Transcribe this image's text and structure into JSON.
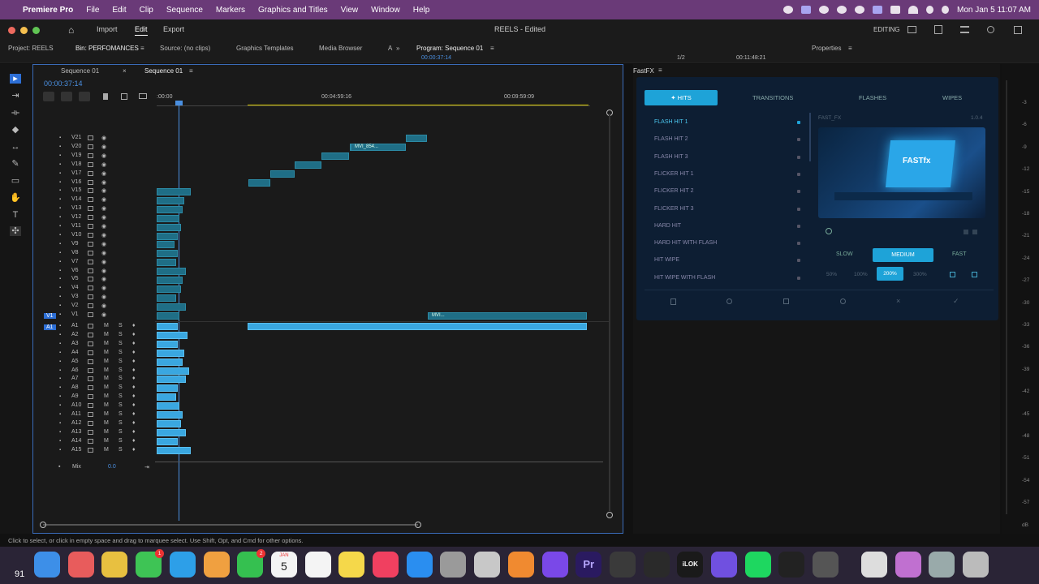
{
  "menubar": {
    "app": "Premiere Pro",
    "items": [
      "File",
      "Edit",
      "Clip",
      "Sequence",
      "Markers",
      "Graphics and Titles",
      "View",
      "Window",
      "Help"
    ],
    "clock": "Mon Jan 5  11:07 AM"
  },
  "apptop": {
    "home": "home-icon",
    "import": "Import",
    "edit": "Edit",
    "export": "Export",
    "title": "REELS - Edited",
    "workspace": "EDITING"
  },
  "tabs": {
    "project": "Project: REELS",
    "bin": "Bin: PERFOMANCES",
    "source": "Source: (no clips)",
    "graphics": "Graphics Templates",
    "media": "Media Browser",
    "more": "A",
    "program": "Program: Sequence 01",
    "program_time": "00:00:37:14",
    "program_dur": "00:11:48:21",
    "program_zoom": "1/2",
    "properties": "Properties"
  },
  "timeline": {
    "seq_tab1": "Sequence 01",
    "seq_tab2": "Sequence 01",
    "timecode": "00:00:37:14",
    "ruler": [
      ":00:00",
      "00:04:59:16",
      "00:09:59:09"
    ],
    "video_tracks": [
      "V21",
      "V20",
      "V19",
      "V18",
      "V17",
      "V16",
      "V15",
      "V14",
      "V13",
      "V12",
      "V11",
      "V10",
      "V9",
      "V8",
      "V7",
      "V6",
      "V5",
      "V4",
      "V3",
      "V2",
      "V1"
    ],
    "audio_tracks": [
      "A1",
      "A2",
      "A3",
      "A4",
      "A5",
      "A6",
      "A7",
      "A8",
      "A9",
      "A10",
      "A11",
      "A12",
      "A13",
      "A14",
      "A15"
    ],
    "v1_src": "V1",
    "a1_src": "A1",
    "mix_label": "Mix",
    "mix_value": "0.0",
    "clip_v20": "MVI_854...",
    "clip_v1": "MVI..."
  },
  "fastfx": {
    "panel_title": "FastFX",
    "tabs": [
      "HITS",
      "TRANSITIONS",
      "FLASHES",
      "WIPES"
    ],
    "items": [
      "FLASH HIT 1",
      "FLASH HIT 2",
      "FLASH HIT 3",
      "FLICKER HIT 1",
      "FLICKER HIT 2",
      "FLICKER HIT 3",
      "HARD HIT",
      "HARD HIT WITH FLASH",
      "HIT WIPE",
      "HIT WIPE WITH FLASH"
    ],
    "preview_name": "FAST_FX",
    "version": "1.0.4",
    "preview_text": "FASTfx",
    "speeds": [
      "SLOW",
      "MEDIUM",
      "FAST"
    ],
    "scales": [
      "50%",
      "100%",
      "200%",
      "300%"
    ]
  },
  "meter": {
    "labels": [
      "-3",
      "-6",
      "-9",
      "-12",
      "-15",
      "-18",
      "-21",
      "-24",
      "-27",
      "-30",
      "-33",
      "-36",
      "-39",
      "-42",
      "-45",
      "-48",
      "-51",
      "-54",
      "-57",
      "dB"
    ]
  },
  "status": "Click to select, or click in empty space and drag to marquee select. Use Shift, Opt, and Cmd for other options.",
  "dock": {
    "calendar_month": "JAN",
    "calendar_day": "5",
    "badge_messages": "1",
    "badge_facetime": "2",
    "left_text": "91",
    "app_pr": "Pr",
    "app_ilok": "iLOK"
  }
}
